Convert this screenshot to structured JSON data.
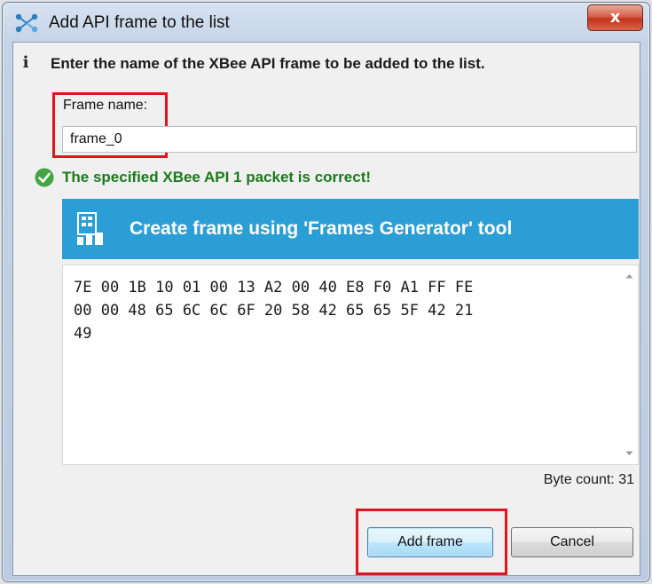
{
  "window": {
    "title": "Add API frame to the list",
    "close_label": "x"
  },
  "dialog": {
    "info_icon": "i",
    "info_text": "Enter the name of the XBee API frame to be added to the list.",
    "frame_name_label": "Frame name:",
    "frame_name_value": "frame_0",
    "status_text": "The specified XBee API 1 packet is correct!",
    "generator_label": "Create frame using 'Frames Generator' tool",
    "packet_hex": "7E 00 1B 10 01 00 13 A2 00 40 E8 F0 A1 FF FE\n00 00 48 65 6C 6C 6F 20 58 42 65 65 5F 42 21\n49",
    "byte_count": "Byte count: 31"
  },
  "buttons": {
    "add": "Add frame",
    "cancel": "Cancel"
  },
  "colors": {
    "generator_bar": "#2c9ed6",
    "status_ok": "#1b7a1b",
    "highlight": "#e2131f"
  },
  "icons": {
    "title": "xbee-network-icon",
    "info": "info-icon",
    "status": "check-circle-icon",
    "generator": "frames-generator-icon",
    "scroll_up": "scroll-up-arrow-icon",
    "scroll_down": "scroll-down-arrow-icon"
  }
}
